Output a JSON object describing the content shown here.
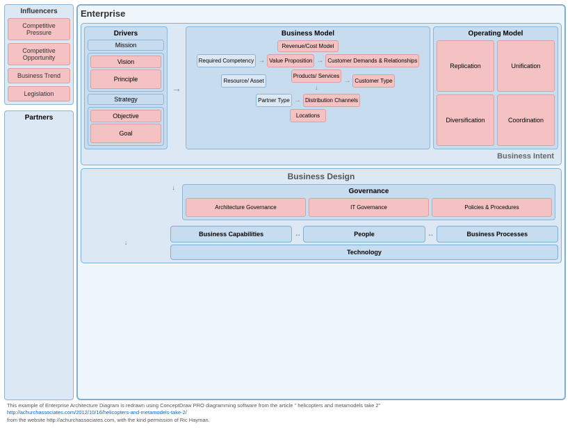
{
  "enterprise": {
    "title": "Enterprise",
    "influencers": {
      "title": "Influencers",
      "items": [
        {
          "label": "Competitive Pressure"
        },
        {
          "label": "Competitive Opportunity"
        },
        {
          "label": "Business Trend"
        },
        {
          "label": "Legislation"
        }
      ]
    },
    "partners": {
      "title": "Partners"
    },
    "drivers": {
      "title": "Drivers",
      "items": [
        "Mission",
        "Vision",
        "Principle",
        "Strategy",
        "Objective",
        "Goal"
      ]
    },
    "business_model": {
      "title": "Business Model",
      "items": [
        "Revenue/Cost Model",
        "Required Competency",
        "Value Proposition",
        "Customer Demands & Relationships",
        "Resource/ Asset",
        "Products/ Services",
        "Customer Type",
        "Partner Type",
        "Distribution Channels",
        "Locations"
      ]
    },
    "operating_model": {
      "title": "Operating Model",
      "items": [
        "Replication",
        "Unification",
        "Diversification",
        "Coordination"
      ]
    },
    "business_intent_label": "Business Intent",
    "business_design": {
      "title": "Business Design",
      "governance": {
        "title": "Governance",
        "items": [
          "Architecture Governance",
          "IT Governance",
          "Policies & Procedures"
        ]
      }
    },
    "capabilities": {
      "items": [
        "Business Capabilities",
        "People",
        "Business Processes"
      ]
    },
    "technology": {
      "label": "Technology"
    }
  },
  "footer": {
    "text1": "This example of Enterprise Architecture Diagram is redrawn using ConceptDraw PRO diagramming software from the article \" helicopters and metamodels take 2\"",
    "link": "http://achurchassociates.com/2012/10/16/helicopters-and-metamodels-take-2/",
    "text2": "from the website http://achurchassociates.com,  with the kind permission of Ric Hayman."
  }
}
